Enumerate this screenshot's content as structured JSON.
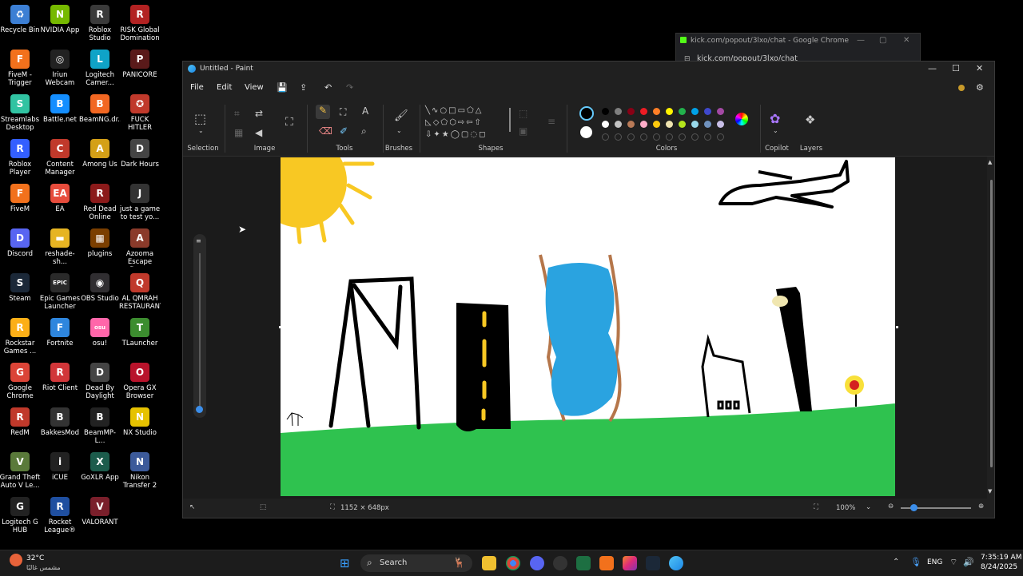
{
  "desktop_icons": [
    {
      "label": "Recycle Bin",
      "color": "#3c7fd4",
      "glyph": "♻"
    },
    {
      "label": "NVIDIA App",
      "color": "#76b900",
      "glyph": "N"
    },
    {
      "label": "Roblox Studio",
      "color": "#3a3a3a",
      "glyph": "R"
    },
    {
      "label": "RISK Global Domination",
      "color": "#b22222",
      "glyph": "R"
    },
    {
      "label": "FiveM - Trigger",
      "color": "#f2711c",
      "glyph": "F"
    },
    {
      "label": "Iriun Webcam",
      "color": "#222",
      "glyph": "◎"
    },
    {
      "label": "Logitech Camer...",
      "color": "#0fa3c7",
      "glyph": "L"
    },
    {
      "label": "PANICORE",
      "color": "#5a1a1a",
      "glyph": "P"
    },
    {
      "label": "Streamlabs Desktop",
      "color": "#31c3a2",
      "glyph": "S"
    },
    {
      "label": "Battle.net",
      "color": "#148eff",
      "glyph": "B"
    },
    {
      "label": "BeamNG.dr...",
      "color": "#f26722",
      "glyph": "B"
    },
    {
      "label": "FUCK HITLER",
      "color": "#c0392b",
      "glyph": "✪"
    },
    {
      "label": "Roblox Player",
      "color": "#335fff",
      "glyph": "R"
    },
    {
      "label": "Content Manager",
      "color": "#c0392b",
      "glyph": "C"
    },
    {
      "label": "Among Us",
      "color": "#d4a017",
      "glyph": "A"
    },
    {
      "label": "Dark Hours",
      "color": "#444",
      "glyph": "D"
    },
    {
      "label": "FiveM",
      "color": "#f2711c",
      "glyph": "F"
    },
    {
      "label": "EA",
      "color": "#e74c3c",
      "glyph": "EA"
    },
    {
      "label": "Red Dead Online",
      "color": "#8b1a1a",
      "glyph": "R"
    },
    {
      "label": "just a game to test yo...",
      "color": "#333",
      "glyph": "J"
    },
    {
      "label": "Discord",
      "color": "#5865f2",
      "glyph": "D"
    },
    {
      "label": "reshade-sh...",
      "color": "#e6b422",
      "glyph": "▬"
    },
    {
      "label": "plugins",
      "color": "#7b3f00",
      "glyph": "▦"
    },
    {
      "label": "Azooma Escape Demo",
      "color": "#8a3a2a",
      "glyph": "A"
    },
    {
      "label": "Steam",
      "color": "#1b2838",
      "glyph": "S"
    },
    {
      "label": "Epic Games Launcher",
      "color": "#2a2a2a",
      "glyph": "EPIC"
    },
    {
      "label": "OBS Studio",
      "color": "#302e31",
      "glyph": "◉"
    },
    {
      "label": "AL QMRAH RESTAURANT",
      "color": "#c0392b",
      "glyph": "Q"
    },
    {
      "label": "Rockstar Games ...",
      "color": "#fcaf17",
      "glyph": "R"
    },
    {
      "label": "Fortnite",
      "color": "#2e86de",
      "glyph": "F"
    },
    {
      "label": "osu!",
      "color": "#ff66aa",
      "glyph": "osu"
    },
    {
      "label": "TLauncher",
      "color": "#3c8d2f",
      "glyph": "T"
    },
    {
      "label": "Google Chrome",
      "color": "#db4437",
      "glyph": "G"
    },
    {
      "label": "Riot Client",
      "color": "#d13639",
      "glyph": "R"
    },
    {
      "label": "Dead By Daylight",
      "color": "#444",
      "glyph": "D"
    },
    {
      "label": "Opera GX Browser",
      "color": "#b8132b",
      "glyph": "O"
    },
    {
      "label": "RedM",
      "color": "#c0392b",
      "glyph": "R"
    },
    {
      "label": "BakkesMod",
      "color": "#333",
      "glyph": "B"
    },
    {
      "label": "BeamMP-L...",
      "color": "#222",
      "glyph": "B"
    },
    {
      "label": "NX Studio",
      "color": "#e6c200",
      "glyph": "N"
    },
    {
      "label": "Grand Theft Auto V Le...",
      "color": "#5a7a3a",
      "glyph": "V"
    },
    {
      "label": "iCUE",
      "color": "#222",
      "glyph": "i"
    },
    {
      "label": "GoXLR App",
      "color": "#1c5c4c",
      "glyph": "X"
    },
    {
      "label": "Nikon Transfer 2",
      "color": "#3c5a9a",
      "glyph": "N"
    },
    {
      "label": "Logitech G HUB",
      "color": "#222",
      "glyph": "G"
    },
    {
      "label": "Rocket League®",
      "color": "#1f4fa0",
      "glyph": "R"
    },
    {
      "label": "VALORANT",
      "color": "#7a1f2b",
      "glyph": "V"
    }
  ],
  "chrome": {
    "title": "kick.com/popout/3lxo/chat - Google Chrome",
    "url": "kick.com/popout/3lxo/chat"
  },
  "paint": {
    "title": "Untitled - Paint",
    "menu": [
      "File",
      "Edit",
      "View"
    ],
    "groups": {
      "selection": "Selection",
      "image": "Image",
      "tools": "Tools",
      "brushes": "Brushes",
      "shapes": "Shapes",
      "colors": "Colors",
      "copilot": "Copilot",
      "layers": "Layers"
    },
    "status": {
      "canvas_size": "1152 × 648px",
      "zoom": "100%"
    },
    "palette_row1": [
      "#000000",
      "#7f7f7f",
      "#880015",
      "#ed1c24",
      "#ff7f27",
      "#fff200",
      "#22b14c",
      "#00a2e8",
      "#3f48cc",
      "#a349a4"
    ],
    "palette_row2": [
      "#ffffff",
      "#c3c3c3",
      "#b97a57",
      "#ffaec9",
      "#ffc90e",
      "#efe4b0",
      "#b5e61d",
      "#99d9ea",
      "#7092be",
      "#c8bfe7"
    ],
    "primary_color": "#000000",
    "secondary_color": "#ffffff"
  },
  "taskbar": {
    "search": "Search",
    "lang": "ENG",
    "time": "7:35:19 AM",
    "date": "8/24/2025",
    "weather_temp": "32°C",
    "weather_desc": "مشمس غالبًا"
  }
}
